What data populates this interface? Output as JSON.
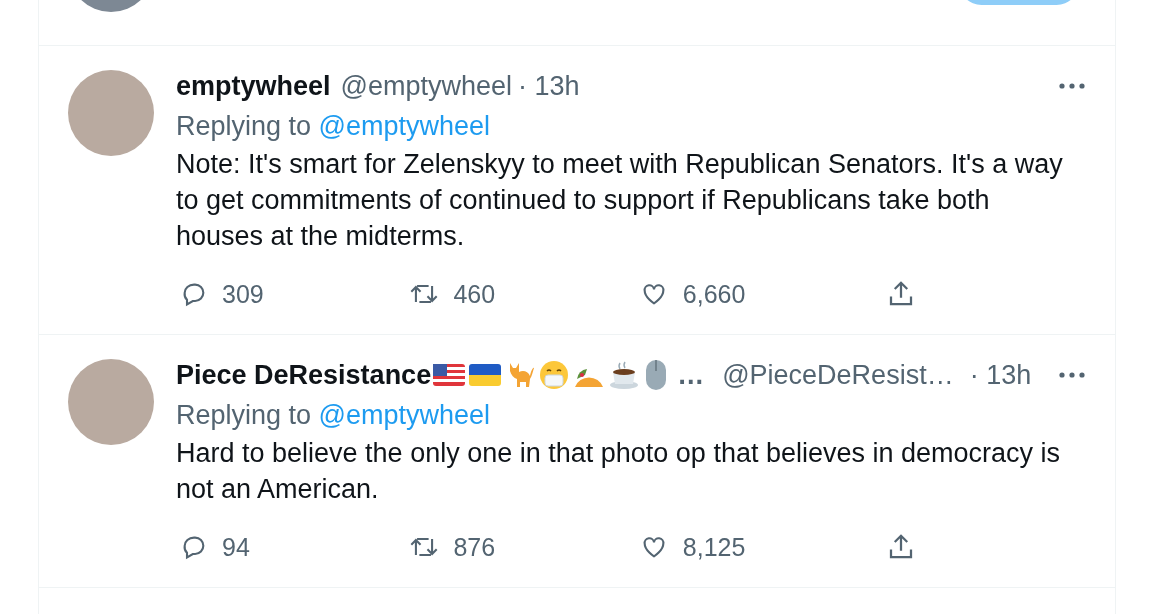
{
  "tweets": [
    {
      "name": "emptywheel",
      "handle": "@emptywheel",
      "time": "· 13h",
      "replying_label": "Replying to",
      "replying_to": "@emptywheel",
      "text": "Note: It's smart for Zelenskyy to meet with Republican Senators. It's a way to get commitments of continued to support if Republicans take both houses at the midterms.",
      "replies": "309",
      "retweets": "460",
      "likes": "6,660"
    },
    {
      "name": "Piece DeResistance",
      "name_badges": [
        {
          "kind": "flag_us"
        },
        {
          "kind": "flag_ua"
        },
        {
          "kind": "cat"
        },
        {
          "kind": "mask"
        },
        {
          "kind": "taco"
        },
        {
          "kind": "coffee"
        },
        {
          "kind": "mouse"
        }
      ],
      "name_ellipsis": "…",
      "handle": "@PieceDeResist…",
      "time": "· 13h",
      "replying_label": "Replying to",
      "replying_to": "@emptywheel",
      "text": "Hard to believe the only one in that photo op that believes in democracy is not an American.",
      "replies": "94",
      "retweets": "876",
      "likes": "8,125"
    }
  ]
}
